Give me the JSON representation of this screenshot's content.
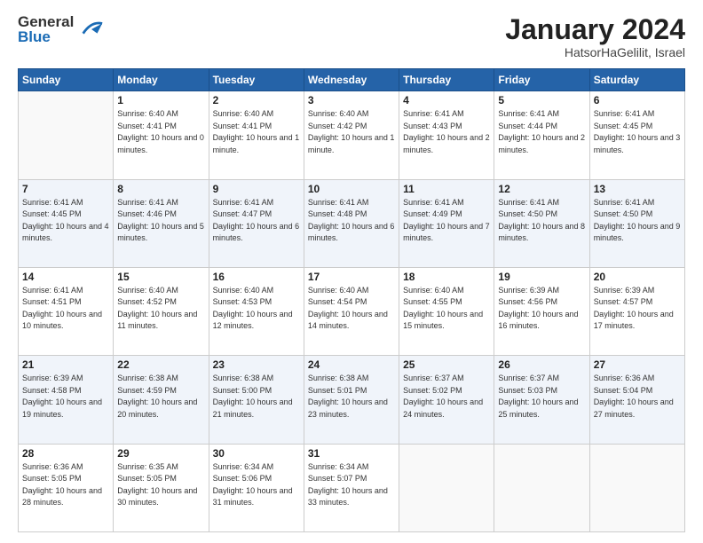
{
  "logo": {
    "general": "General",
    "blue": "Blue"
  },
  "header": {
    "month": "January 2024",
    "location": "HatsorHaGelilit, Israel"
  },
  "weekdays": [
    "Sunday",
    "Monday",
    "Tuesday",
    "Wednesday",
    "Thursday",
    "Friday",
    "Saturday"
  ],
  "weeks": [
    [
      {
        "day": "",
        "sunrise": "",
        "sunset": "",
        "daylight": ""
      },
      {
        "day": "1",
        "sunrise": "Sunrise: 6:40 AM",
        "sunset": "Sunset: 4:41 PM",
        "daylight": "Daylight: 10 hours and 0 minutes."
      },
      {
        "day": "2",
        "sunrise": "Sunrise: 6:40 AM",
        "sunset": "Sunset: 4:41 PM",
        "daylight": "Daylight: 10 hours and 1 minute."
      },
      {
        "day": "3",
        "sunrise": "Sunrise: 6:40 AM",
        "sunset": "Sunset: 4:42 PM",
        "daylight": "Daylight: 10 hours and 1 minute."
      },
      {
        "day": "4",
        "sunrise": "Sunrise: 6:41 AM",
        "sunset": "Sunset: 4:43 PM",
        "daylight": "Daylight: 10 hours and 2 minutes."
      },
      {
        "day": "5",
        "sunrise": "Sunrise: 6:41 AM",
        "sunset": "Sunset: 4:44 PM",
        "daylight": "Daylight: 10 hours and 2 minutes."
      },
      {
        "day": "6",
        "sunrise": "Sunrise: 6:41 AM",
        "sunset": "Sunset: 4:45 PM",
        "daylight": "Daylight: 10 hours and 3 minutes."
      }
    ],
    [
      {
        "day": "7",
        "sunrise": "Sunrise: 6:41 AM",
        "sunset": "Sunset: 4:45 PM",
        "daylight": "Daylight: 10 hours and 4 minutes."
      },
      {
        "day": "8",
        "sunrise": "Sunrise: 6:41 AM",
        "sunset": "Sunset: 4:46 PM",
        "daylight": "Daylight: 10 hours and 5 minutes."
      },
      {
        "day": "9",
        "sunrise": "Sunrise: 6:41 AM",
        "sunset": "Sunset: 4:47 PM",
        "daylight": "Daylight: 10 hours and 6 minutes."
      },
      {
        "day": "10",
        "sunrise": "Sunrise: 6:41 AM",
        "sunset": "Sunset: 4:48 PM",
        "daylight": "Daylight: 10 hours and 6 minutes."
      },
      {
        "day": "11",
        "sunrise": "Sunrise: 6:41 AM",
        "sunset": "Sunset: 4:49 PM",
        "daylight": "Daylight: 10 hours and 7 minutes."
      },
      {
        "day": "12",
        "sunrise": "Sunrise: 6:41 AM",
        "sunset": "Sunset: 4:50 PM",
        "daylight": "Daylight: 10 hours and 8 minutes."
      },
      {
        "day": "13",
        "sunrise": "Sunrise: 6:41 AM",
        "sunset": "Sunset: 4:50 PM",
        "daylight": "Daylight: 10 hours and 9 minutes."
      }
    ],
    [
      {
        "day": "14",
        "sunrise": "Sunrise: 6:41 AM",
        "sunset": "Sunset: 4:51 PM",
        "daylight": "Daylight: 10 hours and 10 minutes."
      },
      {
        "day": "15",
        "sunrise": "Sunrise: 6:40 AM",
        "sunset": "Sunset: 4:52 PM",
        "daylight": "Daylight: 10 hours and 11 minutes."
      },
      {
        "day": "16",
        "sunrise": "Sunrise: 6:40 AM",
        "sunset": "Sunset: 4:53 PM",
        "daylight": "Daylight: 10 hours and 12 minutes."
      },
      {
        "day": "17",
        "sunrise": "Sunrise: 6:40 AM",
        "sunset": "Sunset: 4:54 PM",
        "daylight": "Daylight: 10 hours and 14 minutes."
      },
      {
        "day": "18",
        "sunrise": "Sunrise: 6:40 AM",
        "sunset": "Sunset: 4:55 PM",
        "daylight": "Daylight: 10 hours and 15 minutes."
      },
      {
        "day": "19",
        "sunrise": "Sunrise: 6:39 AM",
        "sunset": "Sunset: 4:56 PM",
        "daylight": "Daylight: 10 hours and 16 minutes."
      },
      {
        "day": "20",
        "sunrise": "Sunrise: 6:39 AM",
        "sunset": "Sunset: 4:57 PM",
        "daylight": "Daylight: 10 hours and 17 minutes."
      }
    ],
    [
      {
        "day": "21",
        "sunrise": "Sunrise: 6:39 AM",
        "sunset": "Sunset: 4:58 PM",
        "daylight": "Daylight: 10 hours and 19 minutes."
      },
      {
        "day": "22",
        "sunrise": "Sunrise: 6:38 AM",
        "sunset": "Sunset: 4:59 PM",
        "daylight": "Daylight: 10 hours and 20 minutes."
      },
      {
        "day": "23",
        "sunrise": "Sunrise: 6:38 AM",
        "sunset": "Sunset: 5:00 PM",
        "daylight": "Daylight: 10 hours and 21 minutes."
      },
      {
        "day": "24",
        "sunrise": "Sunrise: 6:38 AM",
        "sunset": "Sunset: 5:01 PM",
        "daylight": "Daylight: 10 hours and 23 minutes."
      },
      {
        "day": "25",
        "sunrise": "Sunrise: 6:37 AM",
        "sunset": "Sunset: 5:02 PM",
        "daylight": "Daylight: 10 hours and 24 minutes."
      },
      {
        "day": "26",
        "sunrise": "Sunrise: 6:37 AM",
        "sunset": "Sunset: 5:03 PM",
        "daylight": "Daylight: 10 hours and 25 minutes."
      },
      {
        "day": "27",
        "sunrise": "Sunrise: 6:36 AM",
        "sunset": "Sunset: 5:04 PM",
        "daylight": "Daylight: 10 hours and 27 minutes."
      }
    ],
    [
      {
        "day": "28",
        "sunrise": "Sunrise: 6:36 AM",
        "sunset": "Sunset: 5:05 PM",
        "daylight": "Daylight: 10 hours and 28 minutes."
      },
      {
        "day": "29",
        "sunrise": "Sunrise: 6:35 AM",
        "sunset": "Sunset: 5:05 PM",
        "daylight": "Daylight: 10 hours and 30 minutes."
      },
      {
        "day": "30",
        "sunrise": "Sunrise: 6:34 AM",
        "sunset": "Sunset: 5:06 PM",
        "daylight": "Daylight: 10 hours and 31 minutes."
      },
      {
        "day": "31",
        "sunrise": "Sunrise: 6:34 AM",
        "sunset": "Sunset: 5:07 PM",
        "daylight": "Daylight: 10 hours and 33 minutes."
      },
      {
        "day": "",
        "sunrise": "",
        "sunset": "",
        "daylight": ""
      },
      {
        "day": "",
        "sunrise": "",
        "sunset": "",
        "daylight": ""
      },
      {
        "day": "",
        "sunrise": "",
        "sunset": "",
        "daylight": ""
      }
    ]
  ]
}
